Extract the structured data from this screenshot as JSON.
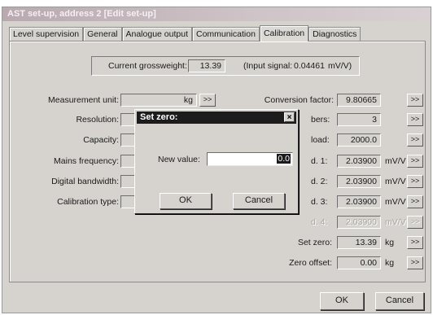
{
  "window": {
    "title": "AST set-up, address 2 [Edit set-up]"
  },
  "tabs": [
    "Level supervision",
    "General",
    "Analogue output",
    "Communication",
    "Calibration",
    "Diagnostics"
  ],
  "gross": {
    "label": "Current grossweight:",
    "value": "13.39",
    "signal_text": "(Input signal:",
    "signal_value": "0.04461",
    "signal_unit": "mV/V)"
  },
  "left": {
    "measurement_unit_label": "Measurement unit:",
    "measurement_unit_value": "kg",
    "resolution_label": "Resolution:",
    "capacity_label": "Capacity:",
    "mains_frequency_label": "Mains frequency:",
    "digital_bandwidth_label": "Digital bandwidth:",
    "calibration_type_label": "Calibration type:"
  },
  "right": {
    "conversion_factor_label": "Conversion factor:",
    "conversion_factor_value": "9.80665",
    "numbers_label_partial": "bers:",
    "numbers_value": "3",
    "load_label_partial": "load:",
    "load_value": "2000.0",
    "pt1_label_partial": "d. 1:",
    "pt1_value": "2.03900",
    "pt2_label_partial": "d. 2:",
    "pt2_value": "2.03900",
    "pt3_label_partial": "d. 3:",
    "pt3_value": "2.03900",
    "pt4_label_partial": "d. 4:",
    "pt4_value": "2.03900",
    "unit_mvv": "mV/V",
    "set_zero_label": "Set zero:",
    "set_zero_value": "13.39",
    "set_zero_unit": "kg",
    "zero_offset_label": "Zero offset:",
    "zero_offset_value": "0.00",
    "zero_offset_unit": "kg"
  },
  "more_button": ">>",
  "footer": {
    "ok": "OK",
    "cancel": "Cancel"
  },
  "dialog": {
    "title": "Set zero:",
    "close": "×",
    "new_value_label": "New value:",
    "new_value": "0.0",
    "ok": "OK",
    "cancel": "Cancel"
  },
  "colors": {
    "face": "#d6d3ce",
    "dialog_title": "#1c1c1c",
    "window_title": "#b9a9b0"
  }
}
